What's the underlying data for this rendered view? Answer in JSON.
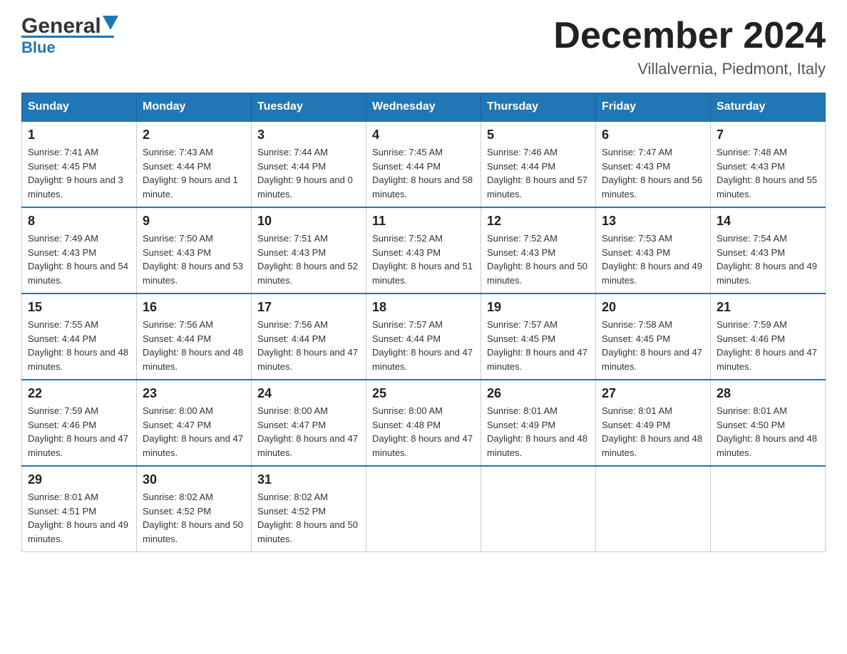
{
  "header": {
    "logo_general": "General",
    "logo_blue": "Blue",
    "month_title": "December 2024",
    "location": "Villalvernia, Piedmont, Italy"
  },
  "days_of_week": [
    "Sunday",
    "Monday",
    "Tuesday",
    "Wednesday",
    "Thursday",
    "Friday",
    "Saturday"
  ],
  "weeks": [
    [
      {
        "day": "1",
        "sunrise": "Sunrise: 7:41 AM",
        "sunset": "Sunset: 4:45 PM",
        "daylight": "Daylight: 9 hours and 3 minutes."
      },
      {
        "day": "2",
        "sunrise": "Sunrise: 7:43 AM",
        "sunset": "Sunset: 4:44 PM",
        "daylight": "Daylight: 9 hours and 1 minute."
      },
      {
        "day": "3",
        "sunrise": "Sunrise: 7:44 AM",
        "sunset": "Sunset: 4:44 PM",
        "daylight": "Daylight: 9 hours and 0 minutes."
      },
      {
        "day": "4",
        "sunrise": "Sunrise: 7:45 AM",
        "sunset": "Sunset: 4:44 PM",
        "daylight": "Daylight: 8 hours and 58 minutes."
      },
      {
        "day": "5",
        "sunrise": "Sunrise: 7:46 AM",
        "sunset": "Sunset: 4:44 PM",
        "daylight": "Daylight: 8 hours and 57 minutes."
      },
      {
        "day": "6",
        "sunrise": "Sunrise: 7:47 AM",
        "sunset": "Sunset: 4:43 PM",
        "daylight": "Daylight: 8 hours and 56 minutes."
      },
      {
        "day": "7",
        "sunrise": "Sunrise: 7:48 AM",
        "sunset": "Sunset: 4:43 PM",
        "daylight": "Daylight: 8 hours and 55 minutes."
      }
    ],
    [
      {
        "day": "8",
        "sunrise": "Sunrise: 7:49 AM",
        "sunset": "Sunset: 4:43 PM",
        "daylight": "Daylight: 8 hours and 54 minutes."
      },
      {
        "day": "9",
        "sunrise": "Sunrise: 7:50 AM",
        "sunset": "Sunset: 4:43 PM",
        "daylight": "Daylight: 8 hours and 53 minutes."
      },
      {
        "day": "10",
        "sunrise": "Sunrise: 7:51 AM",
        "sunset": "Sunset: 4:43 PM",
        "daylight": "Daylight: 8 hours and 52 minutes."
      },
      {
        "day": "11",
        "sunrise": "Sunrise: 7:52 AM",
        "sunset": "Sunset: 4:43 PM",
        "daylight": "Daylight: 8 hours and 51 minutes."
      },
      {
        "day": "12",
        "sunrise": "Sunrise: 7:52 AM",
        "sunset": "Sunset: 4:43 PM",
        "daylight": "Daylight: 8 hours and 50 minutes."
      },
      {
        "day": "13",
        "sunrise": "Sunrise: 7:53 AM",
        "sunset": "Sunset: 4:43 PM",
        "daylight": "Daylight: 8 hours and 49 minutes."
      },
      {
        "day": "14",
        "sunrise": "Sunrise: 7:54 AM",
        "sunset": "Sunset: 4:43 PM",
        "daylight": "Daylight: 8 hours and 49 minutes."
      }
    ],
    [
      {
        "day": "15",
        "sunrise": "Sunrise: 7:55 AM",
        "sunset": "Sunset: 4:44 PM",
        "daylight": "Daylight: 8 hours and 48 minutes."
      },
      {
        "day": "16",
        "sunrise": "Sunrise: 7:56 AM",
        "sunset": "Sunset: 4:44 PM",
        "daylight": "Daylight: 8 hours and 48 minutes."
      },
      {
        "day": "17",
        "sunrise": "Sunrise: 7:56 AM",
        "sunset": "Sunset: 4:44 PM",
        "daylight": "Daylight: 8 hours and 47 minutes."
      },
      {
        "day": "18",
        "sunrise": "Sunrise: 7:57 AM",
        "sunset": "Sunset: 4:44 PM",
        "daylight": "Daylight: 8 hours and 47 minutes."
      },
      {
        "day": "19",
        "sunrise": "Sunrise: 7:57 AM",
        "sunset": "Sunset: 4:45 PM",
        "daylight": "Daylight: 8 hours and 47 minutes."
      },
      {
        "day": "20",
        "sunrise": "Sunrise: 7:58 AM",
        "sunset": "Sunset: 4:45 PM",
        "daylight": "Daylight: 8 hours and 47 minutes."
      },
      {
        "day": "21",
        "sunrise": "Sunrise: 7:59 AM",
        "sunset": "Sunset: 4:46 PM",
        "daylight": "Daylight: 8 hours and 47 minutes."
      }
    ],
    [
      {
        "day": "22",
        "sunrise": "Sunrise: 7:59 AM",
        "sunset": "Sunset: 4:46 PM",
        "daylight": "Daylight: 8 hours and 47 minutes."
      },
      {
        "day": "23",
        "sunrise": "Sunrise: 8:00 AM",
        "sunset": "Sunset: 4:47 PM",
        "daylight": "Daylight: 8 hours and 47 minutes."
      },
      {
        "day": "24",
        "sunrise": "Sunrise: 8:00 AM",
        "sunset": "Sunset: 4:47 PM",
        "daylight": "Daylight: 8 hours and 47 minutes."
      },
      {
        "day": "25",
        "sunrise": "Sunrise: 8:00 AM",
        "sunset": "Sunset: 4:48 PM",
        "daylight": "Daylight: 8 hours and 47 minutes."
      },
      {
        "day": "26",
        "sunrise": "Sunrise: 8:01 AM",
        "sunset": "Sunset: 4:49 PM",
        "daylight": "Daylight: 8 hours and 48 minutes."
      },
      {
        "day": "27",
        "sunrise": "Sunrise: 8:01 AM",
        "sunset": "Sunset: 4:49 PM",
        "daylight": "Daylight: 8 hours and 48 minutes."
      },
      {
        "day": "28",
        "sunrise": "Sunrise: 8:01 AM",
        "sunset": "Sunset: 4:50 PM",
        "daylight": "Daylight: 8 hours and 48 minutes."
      }
    ],
    [
      {
        "day": "29",
        "sunrise": "Sunrise: 8:01 AM",
        "sunset": "Sunset: 4:51 PM",
        "daylight": "Daylight: 8 hours and 49 minutes."
      },
      {
        "day": "30",
        "sunrise": "Sunrise: 8:02 AM",
        "sunset": "Sunset: 4:52 PM",
        "daylight": "Daylight: 8 hours and 50 minutes."
      },
      {
        "day": "31",
        "sunrise": "Sunrise: 8:02 AM",
        "sunset": "Sunset: 4:52 PM",
        "daylight": "Daylight: 8 hours and 50 minutes."
      },
      null,
      null,
      null,
      null
    ]
  ]
}
